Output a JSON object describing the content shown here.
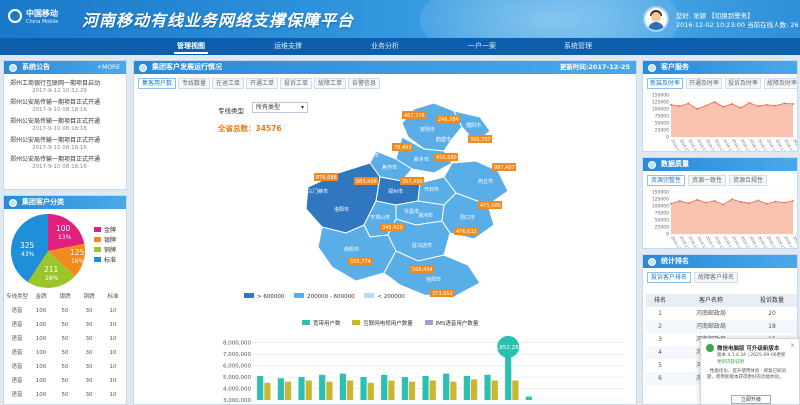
{
  "header": {
    "logo_cn": "中国移动",
    "logo_en": "China Mobile",
    "title": "河南移动有线业务网络支撑保障平台",
    "greeting": "您好, 张颖",
    "switch_role": "【切换到警务】",
    "login_time": "2016-12-02 10:23:00",
    "online_text": "当前在线人数: 26"
  },
  "nav": [
    "管理视图",
    "运维支撑",
    "业务分析",
    "一户一案",
    "系统管理"
  ],
  "notice": {
    "title": "系统公告",
    "more": "+MORE",
    "items": [
      {
        "text": "郑州工商银行互联网一期项目启动",
        "date": "2017-9-12 10:32:29"
      },
      {
        "text": "郑州公安局传输一期项目正式开通",
        "date": "2017-9-10 08:18:16"
      },
      {
        "text": "郑州公安局传输一期项目正式开通",
        "date": "2017-9-10 08:18:16"
      },
      {
        "text": "郑州公安局传输一期项目正式开通",
        "date": "2017-9-10 08:18:16"
      },
      {
        "text": "郑州公安局传输一期项目正式开通",
        "date": "2017-9-10 08:18:16"
      }
    ]
  },
  "customer_class": {
    "title": "集团客户分类",
    "legend": [
      {
        "label": "金牌",
        "color": "#e0207a"
      },
      {
        "label": "银牌",
        "color": "#f28a1e"
      },
      {
        "label": "铜牌",
        "color": "#9ac62b"
      },
      {
        "label": "标准",
        "color": "#1f8fd9"
      }
    ],
    "table_headers": [
      "专线类型",
      "金牌",
      "银牌",
      "铜牌",
      "标准"
    ],
    "rows": [
      [
        "语音",
        "100",
        "50",
        "30",
        "10"
      ],
      [
        "语音",
        "100",
        "50",
        "30",
        "10"
      ],
      [
        "语音",
        "100",
        "50",
        "30",
        "10"
      ],
      [
        "语音",
        "100",
        "50",
        "30",
        "10"
      ],
      [
        "语音",
        "100",
        "50",
        "30",
        "10"
      ],
      [
        "语音",
        "100",
        "50",
        "30",
        "10"
      ],
      [
        "语音",
        "100",
        "50",
        "30",
        "10"
      ],
      [
        "语音",
        "100",
        "50",
        "30",
        "10"
      ]
    ]
  },
  "center": {
    "title": "集团客户发展运行情况",
    "update_label": "更新时间:2017-12-25",
    "tabs": [
      "集客用户数",
      "专线数量",
      "在途工单",
      "开通工单",
      "投诉工单",
      "故障工单",
      "告警信息"
    ],
    "filter_label": "专线类型",
    "filter_value": "所有类型",
    "total_label": "全省总数：34576",
    "map_legend": [
      {
        "label": "> 600000",
        "color": "#2f78c0"
      },
      {
        "label": "200000 - 600000",
        "color": "#59aee8"
      },
      {
        "label": "< 200000",
        "color": "#b8dcf5"
      }
    ],
    "cities": [
      {
        "name": "安阳市"
      },
      {
        "name": "鹤壁市"
      },
      {
        "name": "濮阳市"
      },
      {
        "name": "新乡市"
      },
      {
        "name": "焦作市"
      },
      {
        "name": "济源市"
      },
      {
        "name": "郑州市"
      },
      {
        "name": "开封市"
      },
      {
        "name": "商丘市"
      },
      {
        "name": "三门峡市"
      },
      {
        "name": "洛阳市"
      },
      {
        "name": "许昌市"
      },
      {
        "name": "平顶山市"
      },
      {
        "name": "漯河市"
      },
      {
        "name": "周口市"
      },
      {
        "name": "南阳市"
      },
      {
        "name": "驻马店市"
      },
      {
        "name": "信阳市"
      }
    ],
    "map_values": [
      "467,776",
      "246,784",
      "396,707",
      "78,493",
      "456,580",
      "987,407",
      "876,688",
      "983,498",
      "357,490",
      "345,419",
      "476,632",
      "555,774",
      "568,434",
      "373,651",
      "475,580"
    ],
    "bar_legend": [
      "宽带用户数",
      "互联网电视用户数量",
      "IMS语音用户数量"
    ],
    "bar_y_ticks": [
      "8,000,000",
      "7,000,000",
      "6,000,000",
      "5,000,000",
      "4,000,000",
      "3,000,000"
    ],
    "tooltip_value": "6,852,281"
  },
  "chart_data": {
    "type": "bar",
    "title": "",
    "xlabel": "",
    "ylabel": "",
    "ylim": [
      3000000,
      8500000
    ],
    "categories": [
      "1",
      "2",
      "3",
      "4",
      "5",
      "6",
      "7",
      "8",
      "9",
      "10",
      "11",
      "12",
      "13",
      "14",
      "15",
      "16",
      "17",
      "18"
    ],
    "series": [
      {
        "name": "宽带用户数",
        "color": "#2cc0b0",
        "values": [
          5100000,
          4900000,
          5000000,
          5200000,
          5300000,
          5000000,
          5200000,
          5000000,
          5100000,
          5300000,
          5100000,
          5200000,
          6852281,
          3300000,
          3000000,
          3000000,
          3000000,
          3000000
        ]
      },
      {
        "name": "互联网电视用户数量",
        "color": "#c9b730",
        "values": [
          4500000,
          4600000,
          4700000,
          4600000,
          4700000,
          4500000,
          4700000,
          4600000,
          4700000,
          4600000,
          4800000,
          4700000,
          4700000,
          3000000,
          3000000,
          3000000,
          3000000,
          3000000
        ]
      }
    ]
  },
  "right": {
    "service_title": "客户服务",
    "service_tabs": [
      "新装及时率",
      "开通及时率",
      "投诉及时率",
      "故障及时率"
    ],
    "quality_title": "数据质量",
    "quality_tabs": [
      "资源完整性",
      "资源一致性",
      "资源合规性"
    ],
    "y_ticks": [
      "150000",
      "125000",
      "100000",
      "75000",
      "50000",
      "25000",
      "0"
    ],
    "x_dates": [
      "2016-12-01",
      "2016-12-03",
      "2016-12-05",
      "2016-12-07",
      "2016-12-09",
      "2016-12-11",
      "2016-12-13",
      "2016-12-15",
      "2016-12-17",
      "2016-12-19",
      "2016-12-21",
      "2016-12-23",
      "2016-12-25",
      "2016-12-27",
      "2016-12-29"
    ],
    "service_values": [
      115000,
      110000,
      120000,
      100000,
      112000,
      125000,
      108000,
      118000,
      104000,
      122000,
      110000,
      115000,
      112000,
      120000,
      118000
    ],
    "quality_values": [
      108000,
      118000,
      110000,
      122000,
      112000,
      118000,
      105000,
      124000,
      115000,
      110000,
      120000,
      108000,
      116000,
      112000,
      118000
    ],
    "rank_title": "统计排名",
    "rank_tabs": [
      "投诉客户排名",
      "故障客户排名"
    ],
    "rank_headers": [
      "排名",
      "客户名称",
      "投诉数量"
    ],
    "rank_rows": [
      [
        "1",
        "河南邮政局",
        "20"
      ],
      [
        "2",
        "河南邮政局",
        "18"
      ],
      [
        "3",
        "河南邮政局",
        "15"
      ],
      [
        "4",
        "河南邮政局",
        "14"
      ],
      [
        "5",
        "河南邮政局",
        "12"
      ],
      [
        "6",
        "河南邮政局",
        "10"
      ]
    ]
  },
  "popup": {
    "title": "微信电脑版 可升级新版本",
    "version": "版本 4.1.0.34 | 2025-09-06更新",
    "link": "更新内容说明",
    "note": "· 性能优化，提升使用体验 · 修复已知问题，使用新版本获得更好的功能体验。",
    "button": "立即升级",
    "close": "×"
  }
}
